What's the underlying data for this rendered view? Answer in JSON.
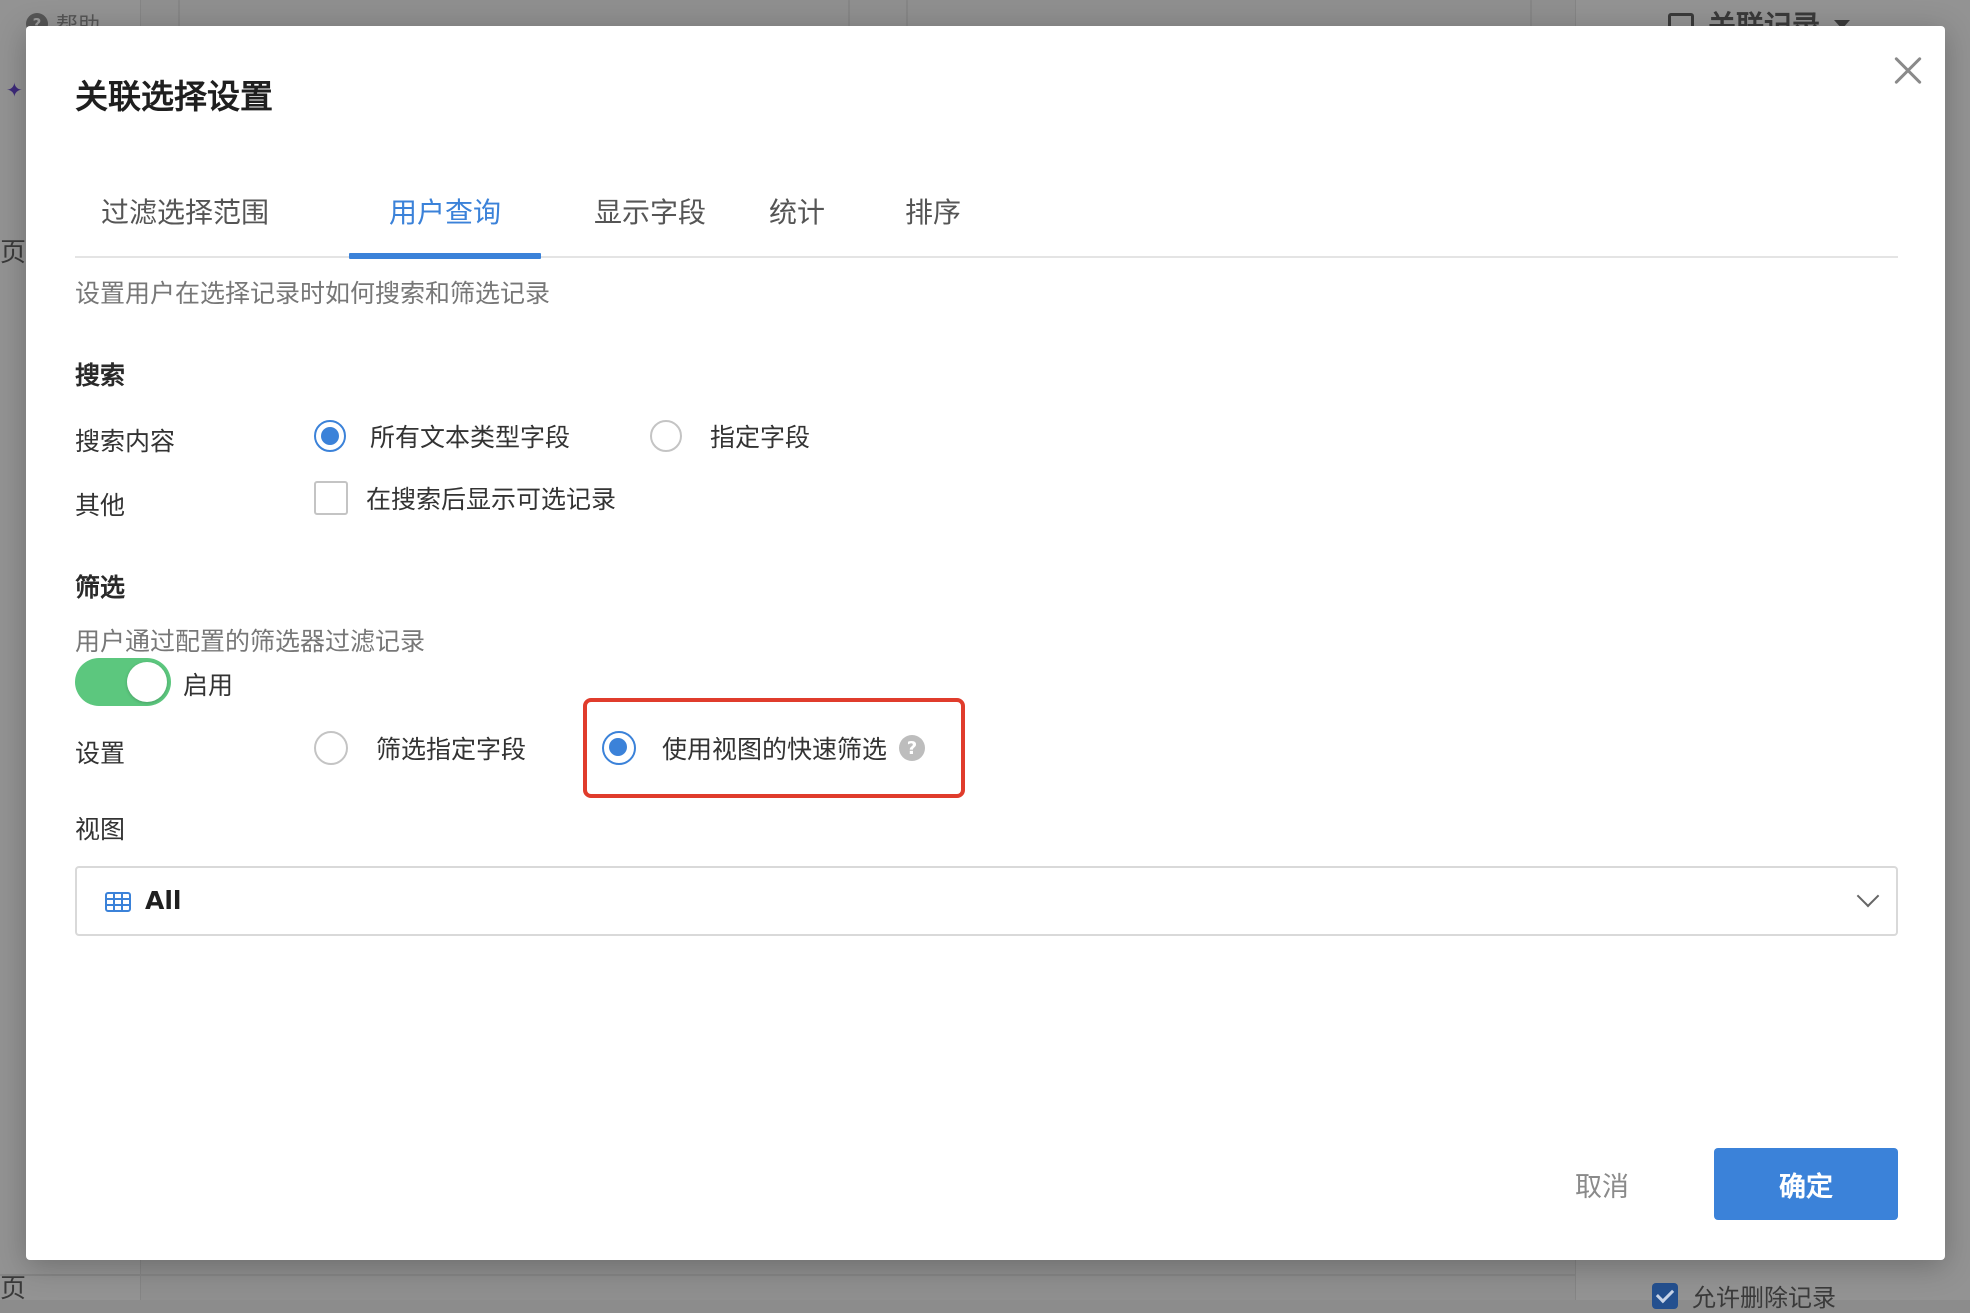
{
  "background": {
    "help_label": "帮助",
    "help_icon": "?",
    "related_records_label": "关联记录",
    "allow_delete_label": "允许删除记录",
    "edge_glyph_top": "页",
    "edge_glyph_bottom": "页"
  },
  "dialog": {
    "title": "关联选择设置",
    "tabs": [
      {
        "label": "过滤选择范围",
        "active": false
      },
      {
        "label": "用户查询",
        "active": true
      },
      {
        "label": "显示字段",
        "active": false
      },
      {
        "label": "统计",
        "active": false
      },
      {
        "label": "排序",
        "active": false
      }
    ],
    "description": "设置用户在选择记录时如何搜索和筛选记录",
    "search": {
      "section_title": "搜索",
      "content_label": "搜索内容",
      "content_options": [
        {
          "label": "所有文本类型字段",
          "checked": true
        },
        {
          "label": "指定字段",
          "checked": false
        }
      ],
      "other_label": "其他",
      "other_checkbox_label": "在搜索后显示可选记录",
      "other_checked": false
    },
    "filter": {
      "section_title": "筛选",
      "description": "用户通过配置的筛选器过滤记录",
      "toggle_label": "启用",
      "toggle_on": true,
      "settings_label": "设置",
      "settings_options": [
        {
          "label": "筛选指定字段",
          "checked": false
        },
        {
          "label": "使用视图的快速筛选",
          "checked": true
        }
      ],
      "help_icon": "?"
    },
    "view": {
      "label": "视图",
      "selected": "All",
      "icon": "grid-table-icon"
    },
    "footer": {
      "cancel_label": "取消",
      "confirm_label": "确定"
    }
  },
  "colors": {
    "accent": "#3b82d9",
    "toggle_on": "#5cc77e",
    "highlight": "#e03c2c"
  }
}
